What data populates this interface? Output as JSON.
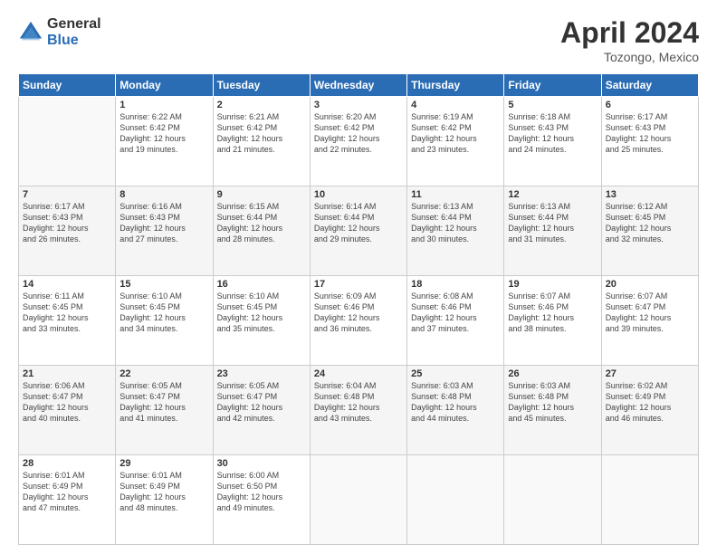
{
  "logo": {
    "general": "General",
    "blue": "Blue"
  },
  "title": "April 2024",
  "location": "Tozongo, Mexico",
  "days_header": [
    "Sunday",
    "Monday",
    "Tuesday",
    "Wednesday",
    "Thursday",
    "Friday",
    "Saturday"
  ],
  "weeks": [
    [
      {
        "num": "",
        "info": ""
      },
      {
        "num": "1",
        "info": "Sunrise: 6:22 AM\nSunset: 6:42 PM\nDaylight: 12 hours\nand 19 minutes."
      },
      {
        "num": "2",
        "info": "Sunrise: 6:21 AM\nSunset: 6:42 PM\nDaylight: 12 hours\nand 21 minutes."
      },
      {
        "num": "3",
        "info": "Sunrise: 6:20 AM\nSunset: 6:42 PM\nDaylight: 12 hours\nand 22 minutes."
      },
      {
        "num": "4",
        "info": "Sunrise: 6:19 AM\nSunset: 6:42 PM\nDaylight: 12 hours\nand 23 minutes."
      },
      {
        "num": "5",
        "info": "Sunrise: 6:18 AM\nSunset: 6:43 PM\nDaylight: 12 hours\nand 24 minutes."
      },
      {
        "num": "6",
        "info": "Sunrise: 6:17 AM\nSunset: 6:43 PM\nDaylight: 12 hours\nand 25 minutes."
      }
    ],
    [
      {
        "num": "7",
        "info": "Sunrise: 6:17 AM\nSunset: 6:43 PM\nDaylight: 12 hours\nand 26 minutes."
      },
      {
        "num": "8",
        "info": "Sunrise: 6:16 AM\nSunset: 6:43 PM\nDaylight: 12 hours\nand 27 minutes."
      },
      {
        "num": "9",
        "info": "Sunrise: 6:15 AM\nSunset: 6:44 PM\nDaylight: 12 hours\nand 28 minutes."
      },
      {
        "num": "10",
        "info": "Sunrise: 6:14 AM\nSunset: 6:44 PM\nDaylight: 12 hours\nand 29 minutes."
      },
      {
        "num": "11",
        "info": "Sunrise: 6:13 AM\nSunset: 6:44 PM\nDaylight: 12 hours\nand 30 minutes."
      },
      {
        "num": "12",
        "info": "Sunrise: 6:13 AM\nSunset: 6:44 PM\nDaylight: 12 hours\nand 31 minutes."
      },
      {
        "num": "13",
        "info": "Sunrise: 6:12 AM\nSunset: 6:45 PM\nDaylight: 12 hours\nand 32 minutes."
      }
    ],
    [
      {
        "num": "14",
        "info": "Sunrise: 6:11 AM\nSunset: 6:45 PM\nDaylight: 12 hours\nand 33 minutes."
      },
      {
        "num": "15",
        "info": "Sunrise: 6:10 AM\nSunset: 6:45 PM\nDaylight: 12 hours\nand 34 minutes."
      },
      {
        "num": "16",
        "info": "Sunrise: 6:10 AM\nSunset: 6:45 PM\nDaylight: 12 hours\nand 35 minutes."
      },
      {
        "num": "17",
        "info": "Sunrise: 6:09 AM\nSunset: 6:46 PM\nDaylight: 12 hours\nand 36 minutes."
      },
      {
        "num": "18",
        "info": "Sunrise: 6:08 AM\nSunset: 6:46 PM\nDaylight: 12 hours\nand 37 minutes."
      },
      {
        "num": "19",
        "info": "Sunrise: 6:07 AM\nSunset: 6:46 PM\nDaylight: 12 hours\nand 38 minutes."
      },
      {
        "num": "20",
        "info": "Sunrise: 6:07 AM\nSunset: 6:47 PM\nDaylight: 12 hours\nand 39 minutes."
      }
    ],
    [
      {
        "num": "21",
        "info": "Sunrise: 6:06 AM\nSunset: 6:47 PM\nDaylight: 12 hours\nand 40 minutes."
      },
      {
        "num": "22",
        "info": "Sunrise: 6:05 AM\nSunset: 6:47 PM\nDaylight: 12 hours\nand 41 minutes."
      },
      {
        "num": "23",
        "info": "Sunrise: 6:05 AM\nSunset: 6:47 PM\nDaylight: 12 hours\nand 42 minutes."
      },
      {
        "num": "24",
        "info": "Sunrise: 6:04 AM\nSunset: 6:48 PM\nDaylight: 12 hours\nand 43 minutes."
      },
      {
        "num": "25",
        "info": "Sunrise: 6:03 AM\nSunset: 6:48 PM\nDaylight: 12 hours\nand 44 minutes."
      },
      {
        "num": "26",
        "info": "Sunrise: 6:03 AM\nSunset: 6:48 PM\nDaylight: 12 hours\nand 45 minutes."
      },
      {
        "num": "27",
        "info": "Sunrise: 6:02 AM\nSunset: 6:49 PM\nDaylight: 12 hours\nand 46 minutes."
      }
    ],
    [
      {
        "num": "28",
        "info": "Sunrise: 6:01 AM\nSunset: 6:49 PM\nDaylight: 12 hours\nand 47 minutes."
      },
      {
        "num": "29",
        "info": "Sunrise: 6:01 AM\nSunset: 6:49 PM\nDaylight: 12 hours\nand 48 minutes."
      },
      {
        "num": "30",
        "info": "Sunrise: 6:00 AM\nSunset: 6:50 PM\nDaylight: 12 hours\nand 49 minutes."
      },
      {
        "num": "",
        "info": ""
      },
      {
        "num": "",
        "info": ""
      },
      {
        "num": "",
        "info": ""
      },
      {
        "num": "",
        "info": ""
      }
    ]
  ]
}
